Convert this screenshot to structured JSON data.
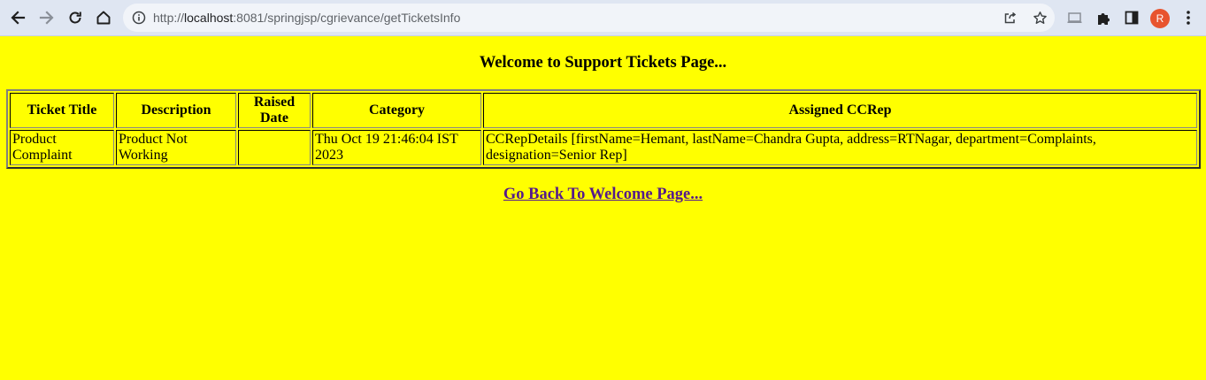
{
  "browser": {
    "url_prefix": "http://",
    "url_host": "localhost",
    "url_rest": ":8081/springjsp/cgrievance/getTicketsInfo",
    "avatar_letter": "R",
    "accent_avatar_color": "#e8542e"
  },
  "page": {
    "background_color": "#ffff00",
    "title": "Welcome to Support Tickets Page...",
    "back_link_label": "Go Back To Welcome Page..."
  },
  "table": {
    "headers": [
      "Ticket Title",
      "Description",
      "Raised Date",
      "Category",
      "Assigned CCRep"
    ],
    "rows": [
      {
        "ticket_title": "Product Complaint",
        "description": "Product Not Working",
        "raised_date": "",
        "category": "Thu Oct 19 21:46:04 IST 2023",
        "assigned_ccrep": "CCRepDetails [firstName=Hemant, lastName=Chandra Gupta, address=RTNagar, department=Complaints, designation=Senior Rep]"
      }
    ]
  },
  "icons": {
    "back": "arrow-left-icon",
    "forward": "arrow-right-icon",
    "reload": "reload-icon",
    "home": "home-icon",
    "site_info": "info-icon",
    "share": "share-icon",
    "bookmark": "star-icon",
    "cast": "cast-icon",
    "extensions": "puzzle-icon",
    "side_panel": "side-panel-icon",
    "menu": "kebab-menu-icon"
  }
}
